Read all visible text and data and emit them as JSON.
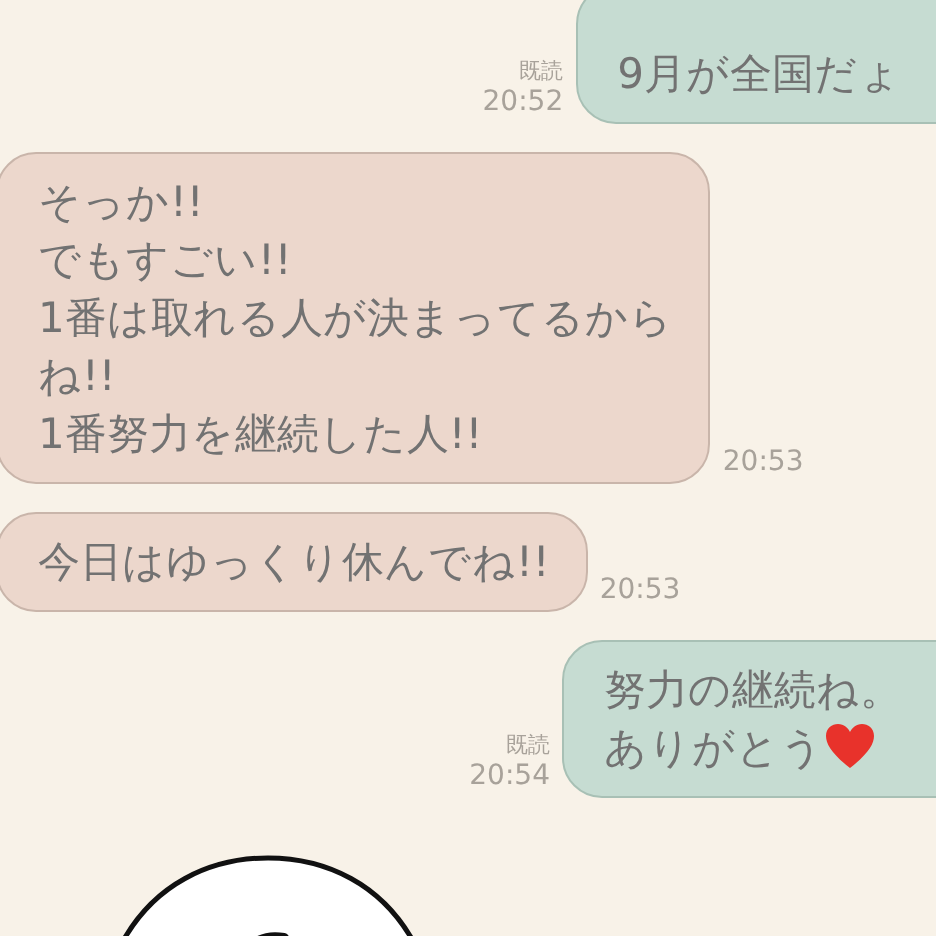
{
  "messages": [
    {
      "kind": "sent",
      "lines": [
        "9月が全国だょ"
      ],
      "read_label": "既読",
      "time": "20:52"
    },
    {
      "kind": "received",
      "lines": [
        "そっか!!",
        "でもすごい!!",
        "1番は取れる人が決まってるから",
        "ね!!",
        "1番努力を継続した人!!"
      ],
      "time": "20:53"
    },
    {
      "kind": "received",
      "lines": [
        "今日はゆっくり休んでね!!"
      ],
      "time": "20:53"
    },
    {
      "kind": "sent",
      "lines": [
        "努力の継続ね。",
        "ありがとう"
      ],
      "heart_emoji": true,
      "read_label": "既読",
      "time": "20:54"
    },
    {
      "kind": "sticker"
    }
  ]
}
